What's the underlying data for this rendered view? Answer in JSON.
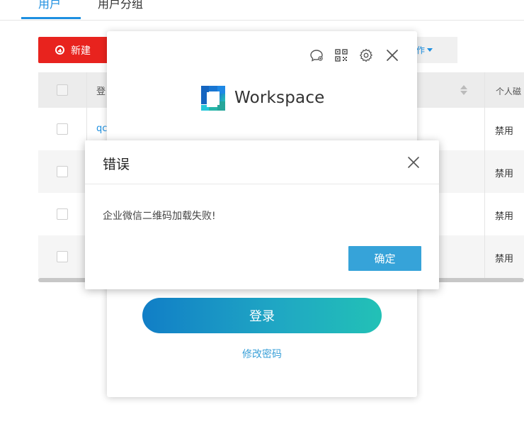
{
  "tabs": [
    {
      "label": "用户",
      "active": true
    },
    {
      "label": "用户分组",
      "active": false
    }
  ],
  "toolbar": {
    "new_label": "新建",
    "more_label": "作",
    "new_color": "#e8231e"
  },
  "table": {
    "headers": {
      "login": "登",
      "personal": "个人磁"
    },
    "rows": [
      {
        "user": "qc",
        "status": "禁用"
      },
      {
        "user": "",
        "status": "禁用"
      },
      {
        "user": "",
        "status": "禁用"
      },
      {
        "user": "",
        "status": "禁用"
      }
    ]
  },
  "login_panel": {
    "brand": "Workspace",
    "login_label": "登录",
    "change_password_label": "修改密码",
    "icons": [
      "chat-icon",
      "qr-code-icon",
      "gear-icon",
      "close-icon"
    ]
  },
  "error_dialog": {
    "title": "错误",
    "message": "企业微信二维码加载失败!",
    "ok_label": "确定",
    "ok_color": "#36a3d9"
  },
  "colors": {
    "accent": "#1d8fe0",
    "gradient_start": "#117ec6",
    "gradient_end": "#22c1b6"
  }
}
